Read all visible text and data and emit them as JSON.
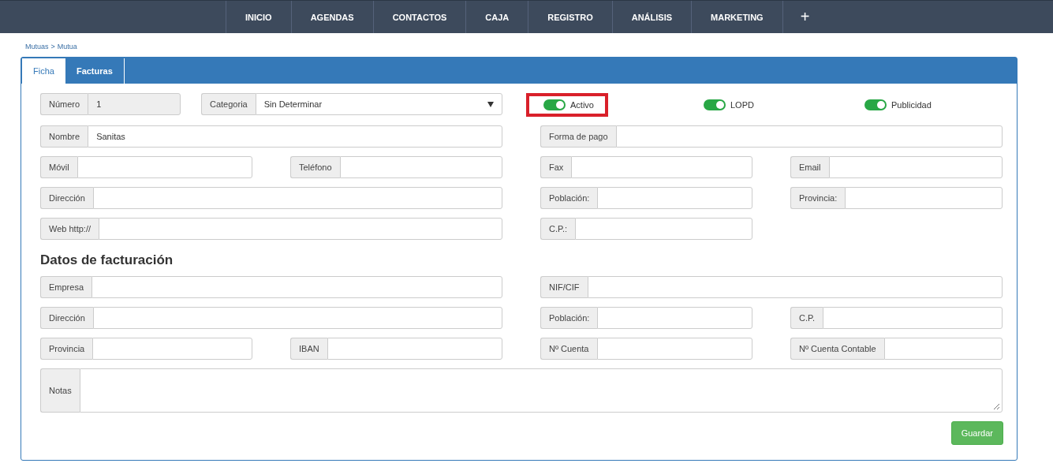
{
  "nav": {
    "items": [
      {
        "label": "INICIO"
      },
      {
        "label": "AGENDAS"
      },
      {
        "label": "CONTACTOS"
      },
      {
        "label": "CAJA"
      },
      {
        "label": "REGISTRO"
      },
      {
        "label": "ANÁLISIS"
      },
      {
        "label": "MARKETING"
      }
    ],
    "add": "+"
  },
  "breadcrumb": {
    "items": [
      "Mutuas",
      "Mutua"
    ],
    "separator": ">"
  },
  "tabs": [
    {
      "label": "Ficha",
      "selected": true
    },
    {
      "label": "Facturas",
      "selected": false
    }
  ],
  "header_row": {
    "numero": {
      "label": "Número",
      "value": "1"
    },
    "categoria": {
      "label": "Categoria",
      "value": "Sin Determinar"
    },
    "toggles": [
      {
        "label": "Activo",
        "on": true,
        "highlighted": true
      },
      {
        "label": "LOPD",
        "on": true,
        "highlighted": false
      },
      {
        "label": "Publicidad",
        "on": true,
        "highlighted": false
      }
    ]
  },
  "fields": [
    {
      "label": "Nombre",
      "value": "Sanitas",
      "wide": true
    },
    {
      "label": "Forma de pago",
      "wide": true
    },
    {
      "label": "Móvil",
      "wide": false
    },
    {
      "label": "Teléfono",
      "wide": false
    },
    {
      "label": "Fax",
      "wide": false
    },
    {
      "label": "Email",
      "wide": false
    },
    {
      "label": "Dirección",
      "wide": true
    },
    {
      "label": "Población:",
      "wide": false
    },
    {
      "label": "Provincia:",
      "wide": false
    },
    {
      "label": "Web http://",
      "wide": true
    },
    {
      "label": "C.P.:",
      "wide": false
    }
  ],
  "billing": {
    "title": "Datos de facturación",
    "fields": [
      {
        "label": "Empresa",
        "wide": true
      },
      {
        "label": "NIF/CIF",
        "wide": true
      },
      {
        "label": "Dirección",
        "wide": true
      },
      {
        "label": "Población:",
        "wide": false
      },
      {
        "label": "C.P.",
        "wide": false
      },
      {
        "label": "Provincia",
        "wide": false
      },
      {
        "label": "IBAN",
        "wide": false
      },
      {
        "label": "Nº Cuenta",
        "wide": false
      },
      {
        "label": "Nº Cuenta Contable",
        "wide": false
      }
    ],
    "notes": {
      "label": "Notas"
    }
  },
  "save": "Guardar"
}
